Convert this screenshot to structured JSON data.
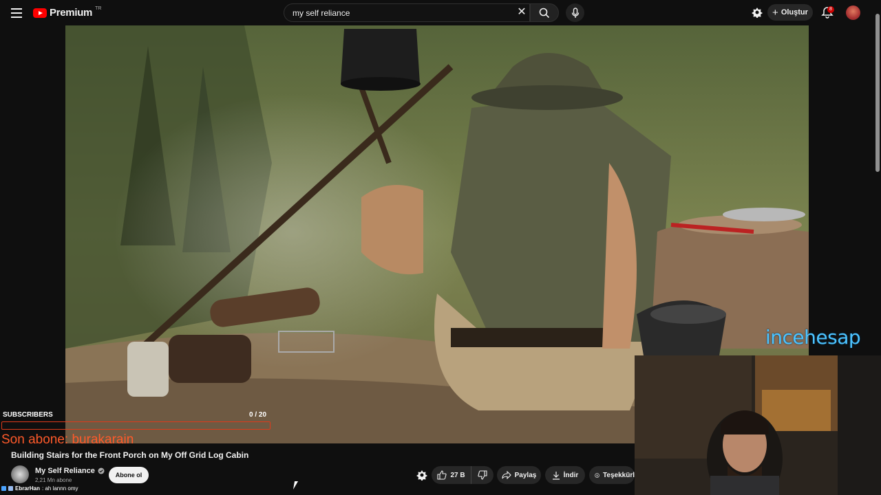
{
  "header": {
    "logo_text": "Premium",
    "logo_sup": "TR",
    "search_value": "my self reliance",
    "create_label": "Oluştur",
    "notification_count": "8",
    "brand_color": "#ff0000"
  },
  "player": {
    "watermark": "incehesap"
  },
  "overlay": {
    "subscribers_label": "SUBSCRIBERS",
    "subscribers_progress": "0  / 20",
    "last_subscriber": "Son abone: burakarain",
    "chat_user": "EbrarHan",
    "chat_message": ": ah lannn omy"
  },
  "video": {
    "title": "Building Stairs for the Front Porch on My Off Grid Log Cabin",
    "channel_name": "My Self Reliance",
    "channel_subs": "2,21 Mn abone",
    "subscribe_label": "Abone ol",
    "like_count": "27 B",
    "share_label": "Paylaş",
    "download_label": "İndir",
    "thanks_label": "Teşekkürl"
  }
}
